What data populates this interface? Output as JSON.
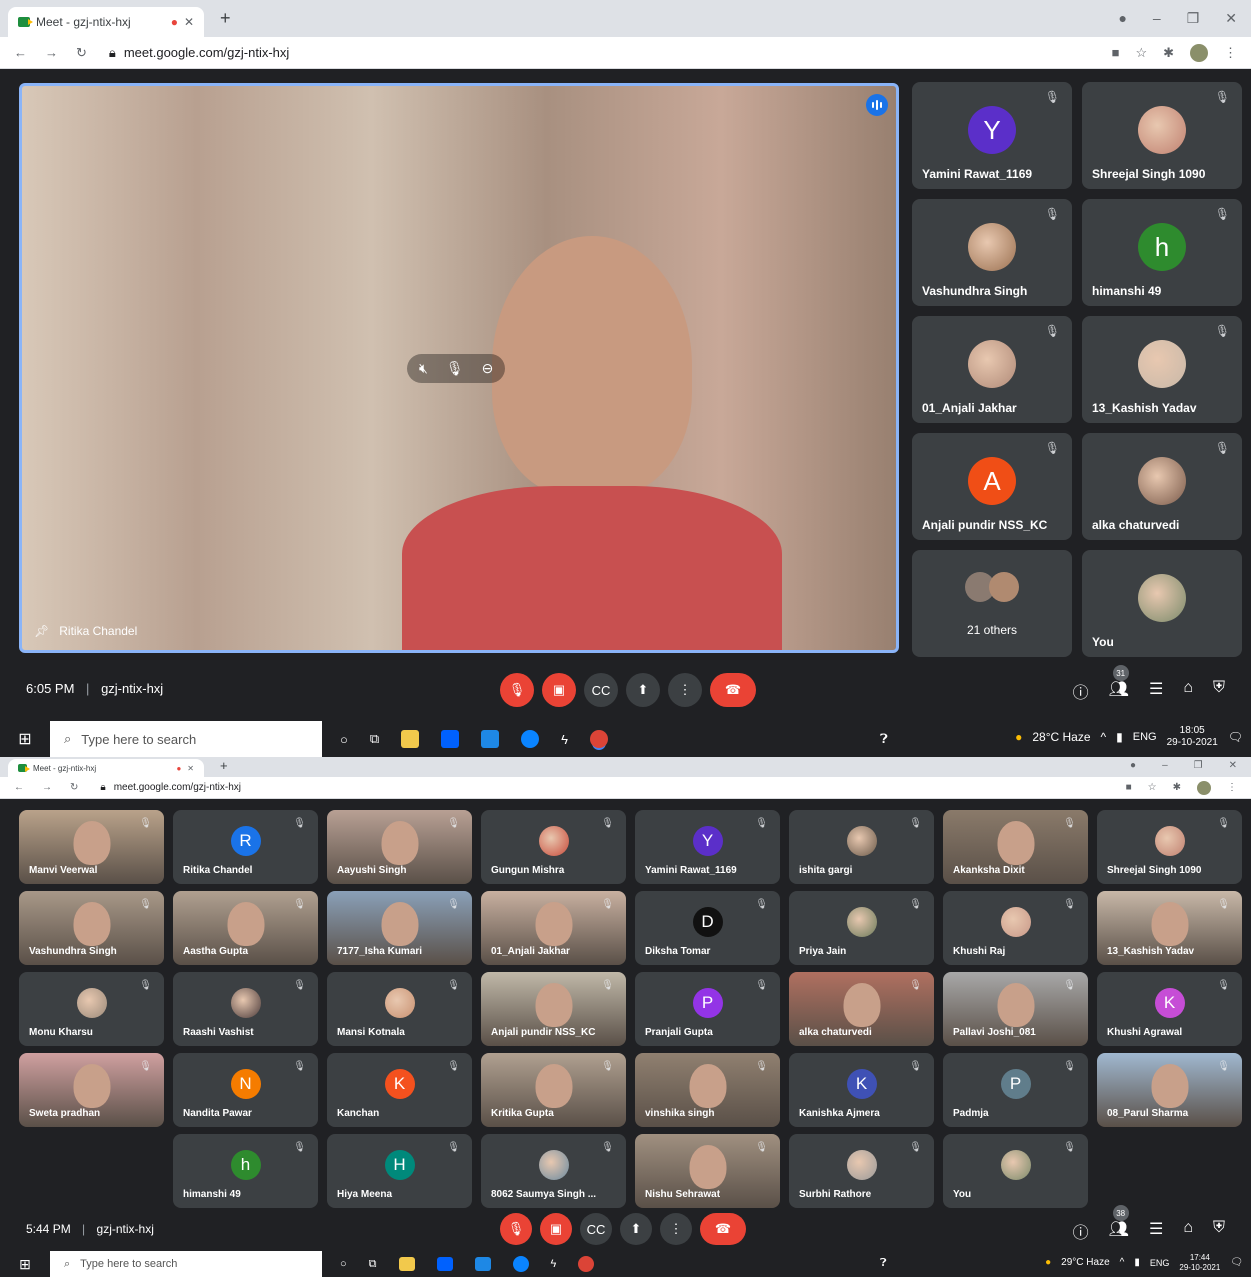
{
  "shot1": {
    "tab_title": "Meet - gzj-ntix-hxj",
    "url": "meet.google.com/gzj-ntix-hxj",
    "speaker_name": "Ritika Chandel",
    "sidebar": [
      {
        "name": "Yamini Rawat_1169",
        "type": "letter",
        "letter": "Y",
        "color": "#5b2fc9"
      },
      {
        "name": "Shreejal Singh 1090",
        "type": "photo",
        "color": "#c08070"
      },
      {
        "name": "Vashundhra Singh",
        "type": "photo",
        "color": "#9a7050"
      },
      {
        "name": "himanshi 49",
        "type": "letter",
        "letter": "h",
        "color": "#2e8b2e"
      },
      {
        "name": "01_Anjali Jakhar",
        "type": "photo",
        "color": "#b08a78"
      },
      {
        "name": "13_Kashish Yadav",
        "type": "photo",
        "color": "#c8b8a8"
      },
      {
        "name": "Anjali pundir NSS_KC",
        "type": "letter",
        "letter": "A",
        "color": "#f04e16"
      },
      {
        "name": "alka chaturvedi",
        "type": "photo",
        "color": "#7a5a4a"
      },
      {
        "name": "21 others",
        "type": "others",
        "color": "#8a7a70"
      },
      {
        "name": "You",
        "type": "photo",
        "color": "#7a8a6a"
      }
    ],
    "time": "6:05 PM",
    "meeting_code": "gzj-ntix-hxj",
    "participant_count": "31",
    "taskbar": {
      "search_placeholder": "Type here to search",
      "weather": "28°C  Haze",
      "lang": "ENG",
      "clock_time": "18:05",
      "clock_date": "29-10-2021"
    }
  },
  "shot2": {
    "tab_title": "Meet - gzj-ntix-hxj",
    "url": "meet.google.com/gzj-ntix-hxj",
    "grid": [
      {
        "name": "Manvi Veerwal",
        "type": "video",
        "color": "#b9a28a"
      },
      {
        "name": "Ritika Chandel",
        "type": "letter",
        "letter": "R",
        "color": "#1a73e8"
      },
      {
        "name": "Aayushi Singh",
        "type": "video",
        "color": "#b8a094"
      },
      {
        "name": "Gungun Mishra",
        "type": "photo",
        "color": "#c84a3a"
      },
      {
        "name": "Yamini Rawat_1169",
        "type": "letter",
        "letter": "Y",
        "color": "#5b2fc9"
      },
      {
        "name": "ishita gargi",
        "type": "photo",
        "color": "#6a5a4a"
      },
      {
        "name": "Akanksha Dixit",
        "type": "video",
        "color": "#8a7a6a"
      },
      {
        "name": "Shreejal Singh 1090",
        "type": "photo",
        "color": "#c08070"
      },
      {
        "name": "Vashundhra Singh",
        "type": "video",
        "color": "#a89888"
      },
      {
        "name": "Aastha Gupta",
        "type": "video",
        "color": "#b0a090"
      },
      {
        "name": "7177_Isha Kumari",
        "type": "video",
        "color": "#8aa0b8"
      },
      {
        "name": "01_Anjali Jakhar",
        "type": "video",
        "color": "#c8b0a0"
      },
      {
        "name": "Diksha Tomar",
        "type": "letter",
        "letter": "D",
        "color": "#111111"
      },
      {
        "name": "Priya Jain",
        "type": "photo",
        "color": "#6a7a5a"
      },
      {
        "name": "Khushi Raj",
        "type": "photo",
        "color": "#c89888"
      },
      {
        "name": "13_Kashish Yadav",
        "type": "video",
        "color": "#c8b8a8"
      },
      {
        "name": "Monu Kharsu",
        "type": "photo",
        "color": "#9a8a7a"
      },
      {
        "name": "Raashi Vashist",
        "type": "photo",
        "color": "#4a3a3a"
      },
      {
        "name": "Mansi Kotnala",
        "type": "photo",
        "color": "#c89070"
      },
      {
        "name": "Anjali pundir NSS_KC",
        "type": "video",
        "color": "#c0b8a8"
      },
      {
        "name": "Pranjali Gupta",
        "type": "letter",
        "letter": "P",
        "color": "#9334e6"
      },
      {
        "name": "alka chaturvedi",
        "type": "video",
        "color": "#b07060"
      },
      {
        "name": "Pallavi Joshi_081",
        "type": "video",
        "color": "#a8a8a8"
      },
      {
        "name": "Khushi Agrawal",
        "type": "letter",
        "letter": "K",
        "color": "#c64dd6"
      },
      {
        "name": "Sweta pradhan",
        "type": "video",
        "color": "#d0a0a0"
      },
      {
        "name": "Nandita Pawar",
        "type": "letter",
        "letter": "N",
        "color": "#f57c00"
      },
      {
        "name": "Kanchan",
        "type": "letter",
        "letter": "K",
        "color": "#f4511e"
      },
      {
        "name": "Kritika Gupta",
        "type": "video",
        "color": "#b0a090"
      },
      {
        "name": "vinshika singh",
        "type": "video",
        "color": "#908070"
      },
      {
        "name": "Kanishka Ajmera",
        "type": "letter",
        "letter": "K",
        "color": "#3f51b5"
      },
      {
        "name": "Padmja",
        "type": "letter",
        "letter": "P",
        "color": "#607d8b"
      },
      {
        "name": "08_Parul Sharma",
        "type": "video",
        "color": "#a0b8d0"
      },
      {
        "name": "himanshi 49",
        "type": "letter",
        "letter": "h",
        "color": "#2e8b2e"
      },
      {
        "name": "Hiya Meena",
        "type": "letter",
        "letter": "H",
        "color": "#00897b"
      },
      {
        "name": "8062 Saumya Singh ...",
        "type": "photo",
        "color": "#6a8aa0"
      },
      {
        "name": "Nishu Sehrawat",
        "type": "video",
        "color": "#a09080"
      },
      {
        "name": "Surbhi Rathore",
        "type": "photo",
        "color": "#9a9a9a"
      },
      {
        "name": "You",
        "type": "photo",
        "color": "#7a8a6a"
      }
    ],
    "time": "5:44 PM",
    "meeting_code": "gzj-ntix-hxj",
    "participant_count": "38",
    "taskbar": {
      "search_placeholder": "Type here to search",
      "weather": "29°C  Haze",
      "lang": "ENG",
      "clock_time": "17:44",
      "clock_date": "29-10-2021"
    }
  },
  "icons": [
    "mic-off-icon",
    "camera-off-icon",
    "captions-icon",
    "present-icon",
    "more-icon",
    "end-call-icon",
    "info-icon",
    "people-icon",
    "chat-icon",
    "activities-icon",
    "host-controls-icon"
  ]
}
